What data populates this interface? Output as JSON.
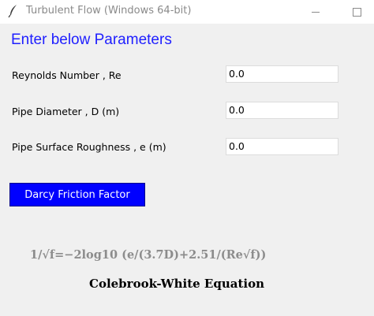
{
  "window": {
    "title": "Turbulent Flow (Windows 64-bit)",
    "icon": "feather-icon",
    "controls": {
      "minimize_icon": "minimize-icon",
      "maximize_icon": "maximize-icon"
    }
  },
  "form": {
    "heading": "Enter below Parameters",
    "heading_color": "#2020ff",
    "fields": [
      {
        "label": "Reynolds Number , Re",
        "value": "0.0"
      },
      {
        "label": "Pipe Diameter , D (m)",
        "value": "0.0"
      },
      {
        "label": "Pipe Surface Roughness , e (m)",
        "value": "0.0"
      }
    ],
    "button_label": "Darcy Friction Factor",
    "button_color": "#0000ff"
  },
  "equation": {
    "formula": "1/√f=−2log10 (e/(3.7D)+2.51/(Re√f))",
    "name": "Colebrook-White Equation",
    "formula_color": "#8c8c8c"
  }
}
